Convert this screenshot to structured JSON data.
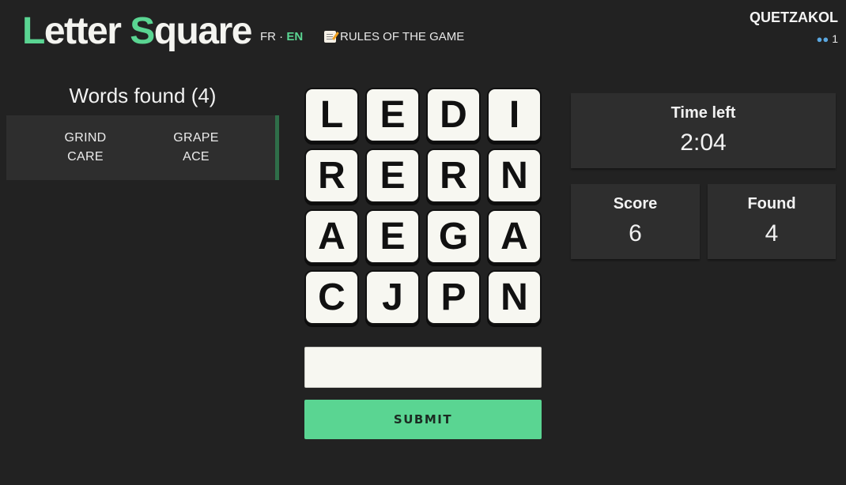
{
  "header": {
    "logo_first_initial": "L",
    "logo_first_rest": "etter",
    "logo_second_initial": "S",
    "logo_second_rest": "quare",
    "lang_fr": "FR",
    "lang_separator": "·",
    "lang_en": "EN",
    "rules_label": "RULES OF THE GAME",
    "rules_icon": "memo-icon"
  },
  "user": {
    "name": "QUETZAKOL",
    "players_icon": "people-icon",
    "players_count": "1"
  },
  "words_found": {
    "title": "Words found (4)",
    "words": [
      "GRIND",
      "GRAPE",
      "CARE",
      "ACE"
    ]
  },
  "board": {
    "rows": [
      [
        "L",
        "E",
        "D",
        "I"
      ],
      [
        "R",
        "E",
        "R",
        "N"
      ],
      [
        "A",
        "E",
        "G",
        "A"
      ],
      [
        "C",
        "J",
        "P",
        "N"
      ]
    ]
  },
  "input": {
    "value": "",
    "placeholder": ""
  },
  "submit_label": "SUBMIT",
  "stats": {
    "time_label": "Time left",
    "time_value": "2:04",
    "score_label": "Score",
    "score_value": "6",
    "found_label": "Found",
    "found_value": "4"
  },
  "colors": {
    "accent": "#5ad592",
    "background": "#222222",
    "panel": "#2e2e2e",
    "tile": "#f7f7f1"
  }
}
